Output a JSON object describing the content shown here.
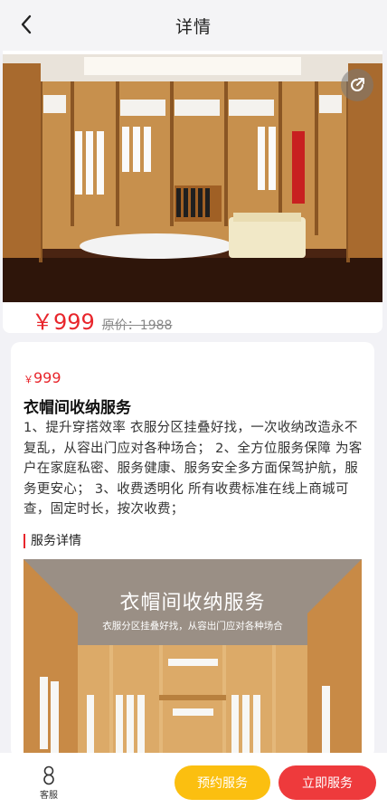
{
  "header": {
    "title": "详情"
  },
  "hero": {
    "price": "￥999",
    "original_price": "原价：1988"
  },
  "info": {
    "price_currency": "￥",
    "price_value": "999",
    "title": "衣帽间收纳服务",
    "description": "1、提升穿搭效率 衣服分区挂叠好找，一次收纳改造永不复乱，从容出门应对各种场合； 2、全方位服务保障 为客户在家庭私密、服务健康、服务安全多方面保驾护航，服务更安心； 3、收费透明化 所有收费标准在线上商城可查，固定时长，按次收费；",
    "section_title": "服务详情",
    "banner_title": "衣帽间收纳服务",
    "banner_subtitle": "衣服分区挂叠好找，从容出门应对各种场合"
  },
  "bottom_bar": {
    "customer_service_label": "客服",
    "book_label": "预约服务",
    "buy_now_label": "立即服务"
  },
  "icons": [
    "back-chevron-icon",
    "share-icon",
    "customer-service-icon"
  ],
  "colors": {
    "accent_red": "#e8262c",
    "book_yellow": "#fbbf10",
    "buy_red": "#ee3a3c"
  }
}
